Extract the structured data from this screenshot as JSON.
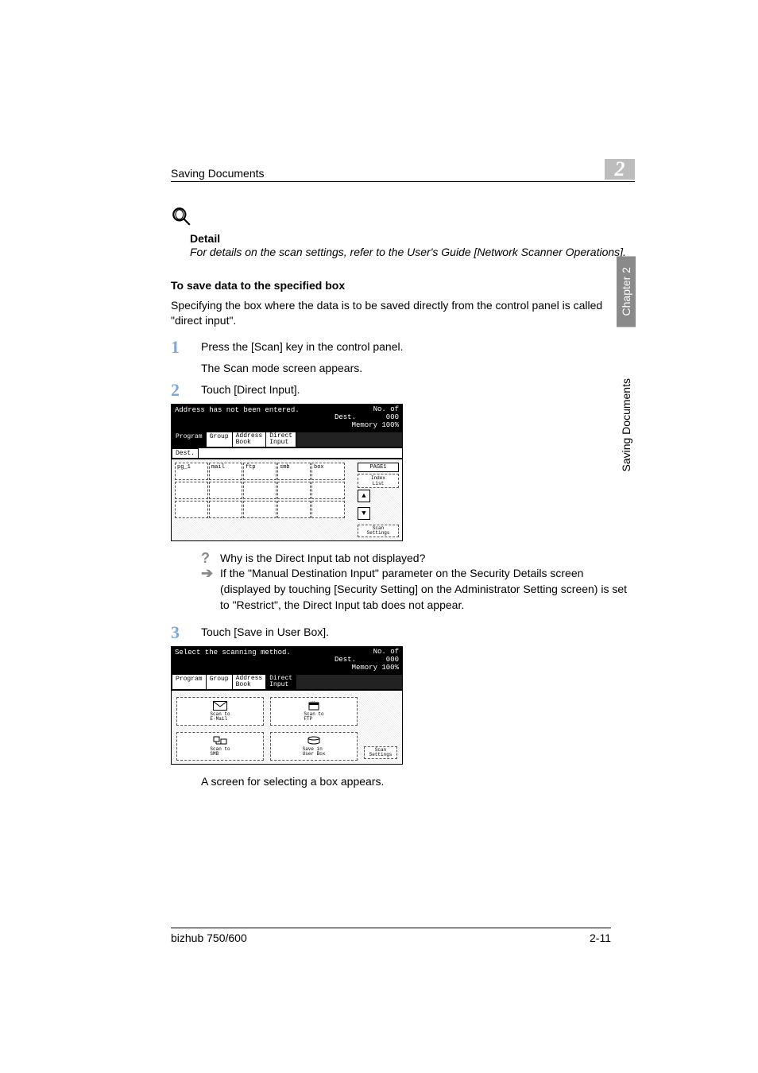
{
  "header": {
    "title": "Saving Documents",
    "chapter_num": "2"
  },
  "side": {
    "chapter": "Chapter 2",
    "saving": "Saving Documents"
  },
  "detail": {
    "label": "Detail",
    "text": "For details on the scan settings, refer to the User's Guide [Network Scanner Operations]."
  },
  "section_heading": "To save data to the specified box",
  "intro": "Specifying the box where the data is to be saved directly from the control panel is called \"direct input\".",
  "steps": {
    "s1": {
      "num": "1",
      "line1": "Press the [Scan] key in the control panel.",
      "line2": "The Scan mode screen appears."
    },
    "s2": {
      "num": "2",
      "line1": "Touch [Direct Input]."
    },
    "s3": {
      "num": "3",
      "line1": "Touch [Save in User Box]."
    }
  },
  "ss1": {
    "bar_left": "Address has not been entered.",
    "bar_r1": "No. of\nDest.       000",
    "bar_r2": "Memory 100%",
    "tabs": [
      "Program",
      "Group",
      "Address\nBook",
      "Direct\nInput"
    ],
    "dest": "Dest.",
    "row": [
      "pg_1",
      "mail",
      "ftp",
      "smb",
      "box"
    ],
    "page": "PAGE1",
    "index": "Index\nList",
    "scan": "Scan\nSettings"
  },
  "ss2": {
    "bar_left": "Select the scanning method.",
    "bar_r1": "No. of\nDest.       000",
    "bar_r2": "Memory 100%",
    "tabs": [
      "Program",
      "Group",
      "Address\nBook",
      "Direct\nInput"
    ],
    "m1": "Scan to\nE-Mail",
    "m2": "Scan to\nFTP",
    "m3": "Scan to\nSMB",
    "m4": "Save in\nUser Box",
    "scan": "Scan\nSettings"
  },
  "qa": {
    "q": "Why is the Direct Input tab not displayed?",
    "a": "If the \"Manual Destination Input\" parameter on the Security Details screen (displayed by touching [Security Setting] on the Administrator Setting screen) is set to \"Restrict\", the Direct Input tab does not appear."
  },
  "after3": "A screen for selecting a box appears.",
  "footer": {
    "left": "bizhub 750/600",
    "right": "2-11"
  }
}
